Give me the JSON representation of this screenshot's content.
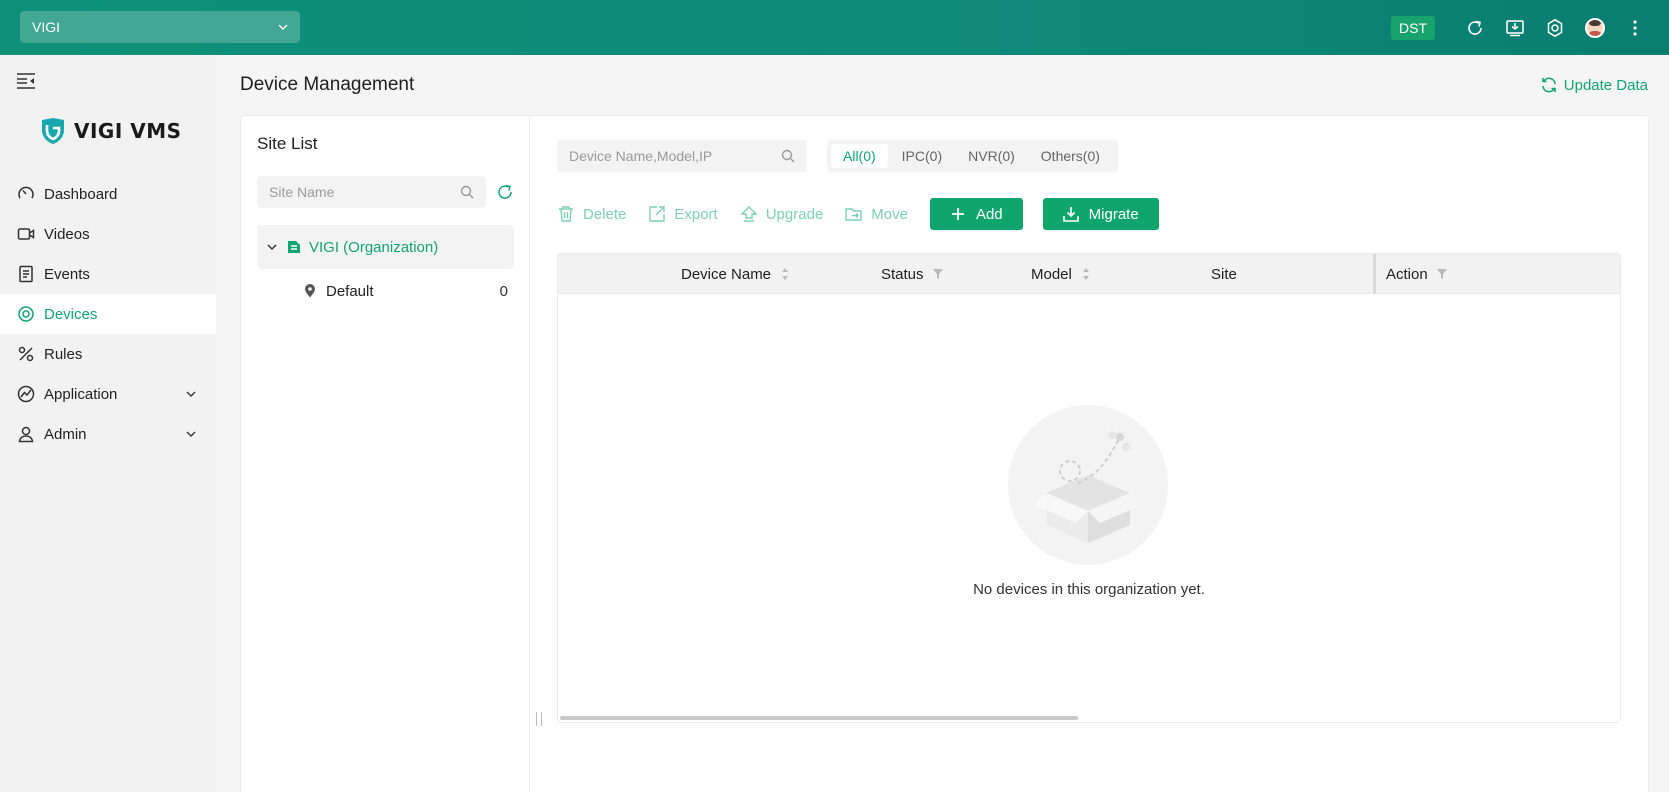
{
  "topbar": {
    "org_selected": "VIGI",
    "dst_label": "DST",
    "icons": [
      "refresh-icon",
      "download-icon",
      "gear-icon",
      "avatar",
      "more-vertical-icon"
    ]
  },
  "sidebar": {
    "logo_text": "VIGI VMS",
    "items": [
      {
        "label": "Dashboard",
        "icon": "dashboard-icon"
      },
      {
        "label": "Videos",
        "icon": "video-icon"
      },
      {
        "label": "Events",
        "icon": "events-icon"
      },
      {
        "label": "Devices",
        "icon": "devices-icon",
        "active": true
      },
      {
        "label": "Rules",
        "icon": "rules-icon"
      },
      {
        "label": "Application",
        "icon": "application-icon",
        "expandable": true
      },
      {
        "label": "Admin",
        "icon": "admin-icon",
        "expandable": true
      }
    ]
  },
  "page": {
    "title": "Device Management",
    "update_data_label": "Update Data"
  },
  "site_list": {
    "title": "Site List",
    "search_placeholder": "Site Name",
    "org_node": "VIGI (Organization)",
    "sites": [
      {
        "name": "Default",
        "count": "0"
      }
    ]
  },
  "devices": {
    "search_placeholder": "Device Name,Model,IP",
    "tabs": [
      {
        "label": "All(0)",
        "active": true
      },
      {
        "label": "IPC(0)"
      },
      {
        "label": "NVR(0)"
      },
      {
        "label": "Others(0)"
      }
    ],
    "toolbar": {
      "delete": "Delete",
      "export": "Export",
      "upgrade": "Upgrade",
      "move": "Move",
      "add": "Add",
      "migrate": "Migrate"
    },
    "columns": {
      "device_name": "Device Name",
      "status": "Status",
      "model": "Model",
      "site": "Site",
      "action": "Action"
    },
    "empty_text": "No devices in this organization yet."
  },
  "colors": {
    "brand": "#11a574",
    "topbar": "#0e8a7b"
  }
}
